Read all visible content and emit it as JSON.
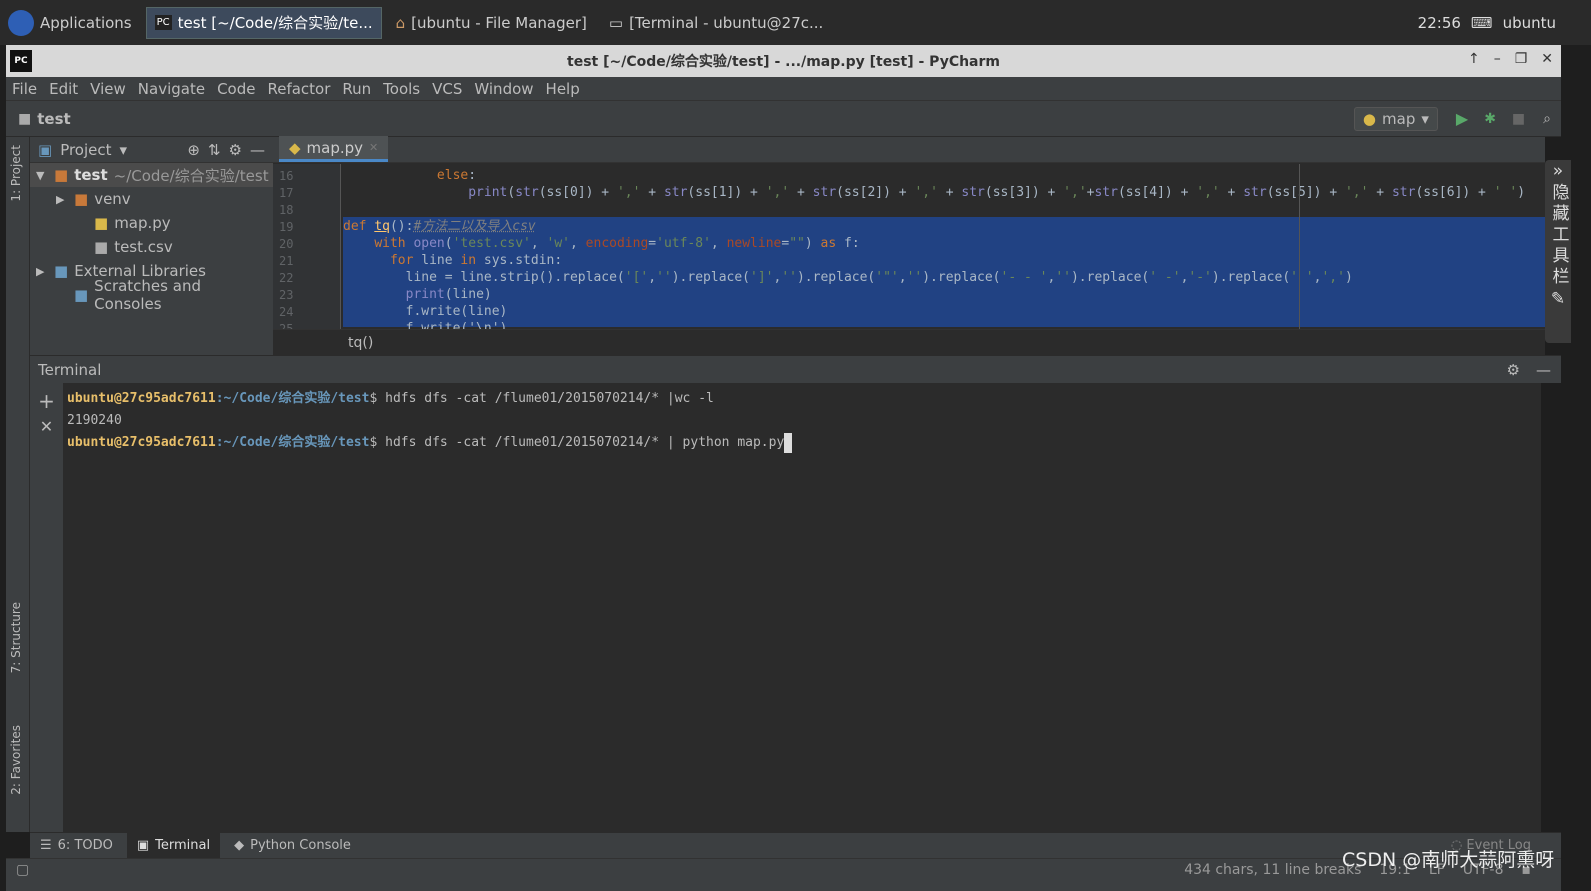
{
  "taskbar": {
    "apps_label": "Applications",
    "windows": [
      "test [~/Code/综合实验/te...",
      "[ubuntu - File Manager]",
      "[Terminal - ubuntu@27c..."
    ],
    "clock": "22:56",
    "user": "ubuntu"
  },
  "window": {
    "title": "test [~/Code/综合实验/test] - .../map.py [test] - PyCharm"
  },
  "menu": [
    "File",
    "Edit",
    "View",
    "Navigate",
    "Code",
    "Refactor",
    "Run",
    "Tools",
    "VCS",
    "Window",
    "Help"
  ],
  "navbar": {
    "crumb": "test",
    "run_config": "map"
  },
  "left_strip": {
    "project": "1: Project",
    "structure": "7: Structure",
    "favorites": "2: Favorites"
  },
  "project": {
    "header": "Project",
    "tree": [
      {
        "label": "test",
        "extra": "~/Code/综合实验/test",
        "icon": "folder-icon",
        "indent": 0,
        "arrow": "▼",
        "bold": true
      },
      {
        "label": "venv",
        "icon": "folder-icon",
        "indent": 1,
        "arrow": "▶"
      },
      {
        "label": "map.py",
        "icon": "python-file-icon",
        "indent": 2,
        "arrow": ""
      },
      {
        "label": "test.csv",
        "icon": "file-icon",
        "indent": 2,
        "arrow": ""
      },
      {
        "label": "External Libraries",
        "icon": "library-icon",
        "indent": 0,
        "arrow": "▶"
      },
      {
        "label": "Scratches and Consoles",
        "icon": "scratches-icon",
        "indent": 1,
        "arrow": ""
      }
    ]
  },
  "editor": {
    "tab": "map.py",
    "breadcrumb": "tq()",
    "lines": [
      {
        "n": "16",
        "tokens": [
          [
            "            ",
            ""
          ],
          [
            "else",
            ""
          ],
          [
            ":",
            ""
          ]
        ],
        "kwfirst": true
      },
      {
        "n": "17",
        "tokens": [
          [
            "                ",
            ""
          ],
          [
            "print",
            "bi"
          ],
          [
            "(",
            ""
          ],
          [
            "str",
            "bi"
          ],
          [
            "(ss[0]) + ",
            ""
          ],
          [
            "','",
            "st"
          ],
          [
            " + ",
            ""
          ],
          [
            "str",
            "bi"
          ],
          [
            "(ss[1]) + ",
            ""
          ],
          [
            "','",
            "st"
          ],
          [
            " + ",
            ""
          ],
          [
            "str",
            "bi"
          ],
          [
            "(ss[2]) + ",
            ""
          ],
          [
            "','",
            "st"
          ],
          [
            " + ",
            ""
          ],
          [
            "str",
            "bi"
          ],
          [
            "(ss[3]) + ",
            ""
          ],
          [
            "','",
            "st"
          ],
          [
            "+",
            ""
          ],
          [
            "str",
            "bi"
          ],
          [
            "(ss[4]) + ",
            ""
          ],
          [
            "','",
            "st"
          ],
          [
            " + ",
            ""
          ],
          [
            "str",
            "bi"
          ],
          [
            "(ss[5]) + ",
            ""
          ],
          [
            "','",
            "st"
          ],
          [
            " + ",
            ""
          ],
          [
            "str",
            "bi"
          ],
          [
            "(ss[6]) + ",
            ""
          ],
          [
            "' '",
            "st"
          ],
          [
            ")",
            ""
          ]
        ]
      },
      {
        "n": "18",
        "tokens": []
      },
      {
        "n": "19",
        "tokens": [
          [
            "def",
            "kw"
          ],
          [
            " ",
            ""
          ],
          [
            "tq",
            "fn"
          ],
          [
            "():",
            ""
          ],
          [
            "#方法二以及导入csv",
            "cm"
          ]
        ]
      },
      {
        "n": "20",
        "tokens": [
          [
            "    ",
            ""
          ],
          [
            "with",
            "kw"
          ],
          [
            " ",
            ""
          ],
          [
            "open",
            "bi"
          ],
          [
            "(",
            ""
          ],
          [
            "'test.csv'",
            "st"
          ],
          [
            ", ",
            ""
          ],
          [
            "'w'",
            "st"
          ],
          [
            ", ",
            ""
          ],
          [
            "encoding",
            "pm"
          ],
          [
            "=",
            ""
          ],
          [
            "'utf-8'",
            "st"
          ],
          [
            ", ",
            ""
          ],
          [
            "newline",
            "pm"
          ],
          [
            "=",
            ""
          ],
          [
            "\"\"",
            "st"
          ],
          [
            ") ",
            ""
          ],
          [
            "as",
            "kw"
          ],
          [
            " f:",
            ""
          ]
        ]
      },
      {
        "n": "21",
        "tokens": [
          [
            "      ",
            ""
          ],
          [
            "for",
            "kw"
          ],
          [
            " line ",
            ""
          ],
          [
            "in",
            "kw"
          ],
          [
            " sys.stdin:",
            ""
          ]
        ]
      },
      {
        "n": "22",
        "tokens": [
          [
            "        line = line.strip().replace(",
            ""
          ],
          [
            "'['",
            "st"
          ],
          [
            ",",
            ""
          ],
          [
            "''",
            "st"
          ],
          [
            ").replace(",
            ""
          ],
          [
            "']'",
            "st"
          ],
          [
            ",",
            ""
          ],
          [
            "''",
            "st"
          ],
          [
            ").replace(",
            ""
          ],
          [
            "'\"'",
            "st"
          ],
          [
            ",",
            ""
          ],
          [
            "''",
            "st"
          ],
          [
            ").replace(",
            ""
          ],
          [
            "'- - '",
            "st"
          ],
          [
            ",",
            ""
          ],
          [
            "''",
            "st"
          ],
          [
            ").replace(",
            ""
          ],
          [
            "' -'",
            "st"
          ],
          [
            ",",
            ""
          ],
          [
            "'-'",
            "st"
          ],
          [
            ").replace(",
            ""
          ],
          [
            "' '",
            "st"
          ],
          [
            ",",
            ""
          ],
          [
            "','",
            "st"
          ],
          [
            ")",
            ""
          ]
        ]
      },
      {
        "n": "23",
        "tokens": [
          [
            "        ",
            ""
          ],
          [
            "print",
            "bi"
          ],
          [
            "(line)",
            ""
          ]
        ]
      },
      {
        "n": "24",
        "tokens": [
          [
            "        f.write(line)",
            ""
          ]
        ]
      },
      {
        "n": "25",
        "tokens": [
          [
            "        f.write('\\n')",
            ""
          ]
        ]
      }
    ]
  },
  "terminal": {
    "title": "Terminal",
    "lines": [
      {
        "user": "ubuntu@27c95adc7611",
        "path": ":~/Code/综合实验/test",
        "cmd": "$ hdfs dfs -cat /flume01/2015070214/* |wc -l"
      },
      {
        "output": "2190240"
      },
      {
        "user": "ubuntu@27c95adc7611",
        "path": ":~/Code/综合实验/test",
        "cmd": "$ hdfs dfs -cat /flume01/2015070214/* | python map.py"
      }
    ]
  },
  "bottom_tabs": [
    "6: TODO",
    "Terminal",
    "Python Console"
  ],
  "status": {
    "selection": "434 chars, 11 line breaks",
    "position": "19:1",
    "line_sep": "LF",
    "encoding": "UTF-8",
    "event_log": "Event Log"
  },
  "side_panel": {
    "label": "隐藏工具栏"
  },
  "watermark": "CSDN @南师大蒜阿熏呀"
}
